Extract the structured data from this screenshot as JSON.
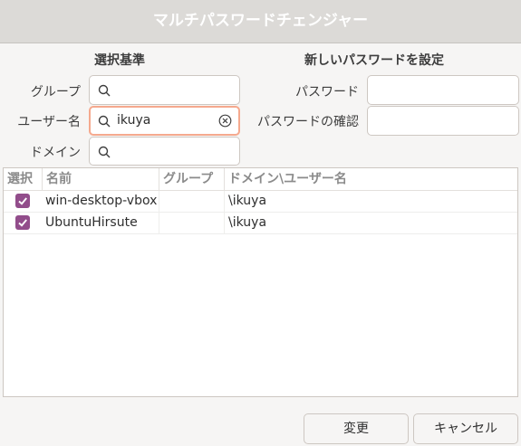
{
  "window": {
    "title": "マルチパスワードチェンジャー"
  },
  "selection": {
    "heading": "選択基準",
    "group_label": "グループ",
    "group_value": "",
    "user_label": "ユーザー名",
    "user_value": "ikuya",
    "domain_label": "ドメイン",
    "domain_value": ""
  },
  "password": {
    "heading": "新しいパスワードを設定",
    "password_label": "パスワード",
    "confirm_label": "パスワードの確認"
  },
  "table": {
    "columns": [
      "選択",
      "名前",
      "グループ",
      "ドメイン\\ユーザー名"
    ],
    "rows": [
      {
        "checked": true,
        "name": "win-desktop-vbox",
        "group": "",
        "account": "\\ikuya"
      },
      {
        "checked": true,
        "name": "UbuntuHirsute",
        "group": "",
        "account": "\\ikuya"
      }
    ]
  },
  "buttons": {
    "change": "変更",
    "cancel": "キャンセル"
  },
  "colors": {
    "accent": "#924d8b",
    "focus_border": "#f5a98e",
    "titlebar": "#dcdad7"
  }
}
